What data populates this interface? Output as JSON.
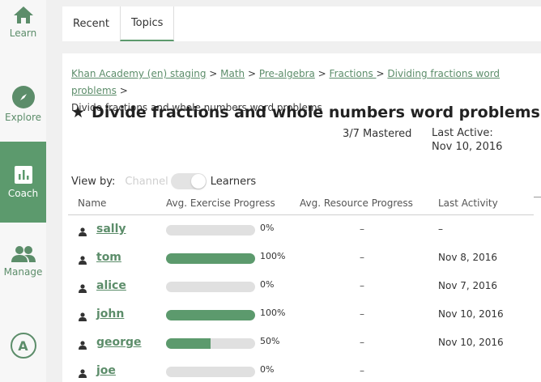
{
  "nav": {
    "learn": "Learn",
    "explore": "Explore",
    "coach": "Coach",
    "manage": "Manage",
    "account_initial": "A"
  },
  "tabs": [
    {
      "label": "Recent",
      "active": false
    },
    {
      "label": "Topics",
      "active": true
    }
  ],
  "breadcrumb": {
    "links": [
      "Khan Academy (en) staging",
      "Math",
      "Pre-algebra",
      "Fractions ",
      "Dividing fractions word problems"
    ],
    "separator": " > ",
    "current": "Divide fractions and whole numbers word problems"
  },
  "title": "Divide fractions and whole numbers word problems",
  "mastered": "3/7 Mastered",
  "last_active_label": "Last Active:",
  "last_active_date": "Nov 10, 2016",
  "view_by": {
    "label": "View by:",
    "option_off": "Channel",
    "option_on": "Learners"
  },
  "columns": [
    "Name",
    "Avg. Exercise Progress",
    "Avg. Resource Progress",
    "Last Activity"
  ],
  "learners": [
    {
      "name": "sally",
      "progress": 0,
      "progress_label": "0%",
      "resource": "–",
      "last_activity": "–"
    },
    {
      "name": "tom",
      "progress": 100,
      "progress_label": "100%",
      "resource": "–",
      "last_activity": "Nov 8, 2016"
    },
    {
      "name": "alice",
      "progress": 0,
      "progress_label": "0%",
      "resource": "–",
      "last_activity": "Nov 7, 2016"
    },
    {
      "name": "john",
      "progress": 100,
      "progress_label": "100%",
      "resource": "–",
      "last_activity": "Nov 10, 2016"
    },
    {
      "name": "george",
      "progress": 50,
      "progress_label": "50%",
      "resource": "–",
      "last_activity": "Nov 10, 2016"
    },
    {
      "name": "joe",
      "progress": 0,
      "progress_label": "0%",
      "resource": "–",
      "last_activity": ""
    }
  ],
  "colors": {
    "accent": "#5c9a6d",
    "link": "#5c8d6a",
    "bar_bg": "#e0e0e0"
  }
}
